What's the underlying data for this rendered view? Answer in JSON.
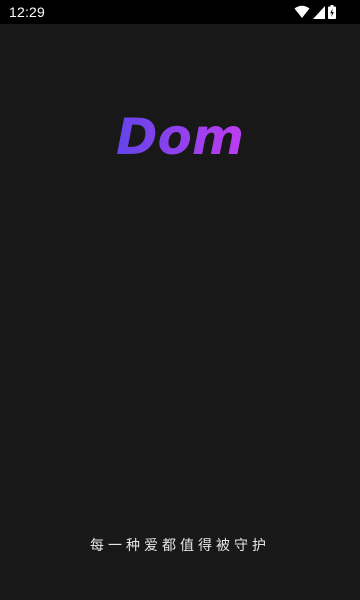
{
  "status_bar": {
    "time": "12:29",
    "icons": [
      "wifi-icon",
      "cellular-signal-icon",
      "battery-charging-icon"
    ]
  },
  "splash": {
    "app_name": "Dom",
    "slogan": "每一种爱都值得被守护"
  },
  "colors": {
    "background": "#181818",
    "status_bar": "#000000",
    "logo_gradient_start": "#5b45e8",
    "logo_gradient_end": "#c93cf2",
    "slogan_text": "#e6e6e6"
  }
}
